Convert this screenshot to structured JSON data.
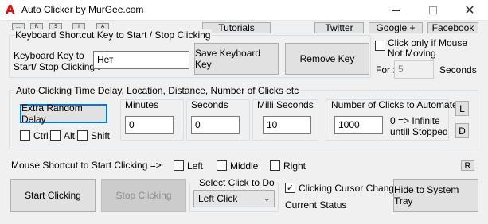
{
  "window": {
    "title": "Auto Clicker by MurGee.com",
    "app_icon_glyph": "A",
    "close_glyph": "✕"
  },
  "mini_toolbar": [
    "...",
    "R",
    "S",
    "I",
    "A"
  ],
  "top_links": {
    "tutorials": "Tutorials",
    "twitter": "Twitter",
    "google": "Google +",
    "facebook": "Facebook"
  },
  "shortcut_group": {
    "title": "Keyboard Shortcut Key to Start / Stop Clicking",
    "key_label_line1": "Keyboard Key to",
    "key_label_line2": "Start/ Stop Clicking :",
    "key_value": "Нет",
    "save_button": "Save Keyboard Key",
    "remove_button": "Remove Key"
  },
  "mouse_move": {
    "label_line1": "Click only if Mouse",
    "label_line2": "Not Moving",
    "checked": false,
    "for_label": "For :",
    "for_value": "5",
    "seconds_label": "Seconds"
  },
  "delay_group": {
    "title": "Auto Clicking Time Delay, Location, Distance, Number of Clicks etc",
    "extra_random_delay": "Extra Random Delay",
    "ctrl": "Ctrl",
    "alt": "Alt",
    "shift": "Shift",
    "minutes_label": "Minutes",
    "minutes_value": "0",
    "seconds_label": "Seconds",
    "seconds_value": "0",
    "milli_label": "Milli Seconds",
    "milli_value": "10",
    "clicks_label": "Number of Clicks to Automate",
    "clicks_value": "1000",
    "infinite_line1": "0 => Infinite",
    "infinite_line2": "untill Stopped",
    "l_button": "L",
    "d_button": "D"
  },
  "mouse_shortcut": {
    "label": "Mouse Shortcut to Start Clicking =>",
    "left": "Left",
    "middle": "Middle",
    "right": "Right",
    "r_button": "R"
  },
  "bottom": {
    "start_button": "Start Clicking",
    "stop_button": "Stop Clicking",
    "select_title": "Select Click to Do",
    "select_value": "Left Click",
    "cursor_change": "Clicking Cursor Change",
    "cursor_change_checked": true,
    "current_status": "Current Status",
    "hide_button": "Hide to System Tray"
  }
}
